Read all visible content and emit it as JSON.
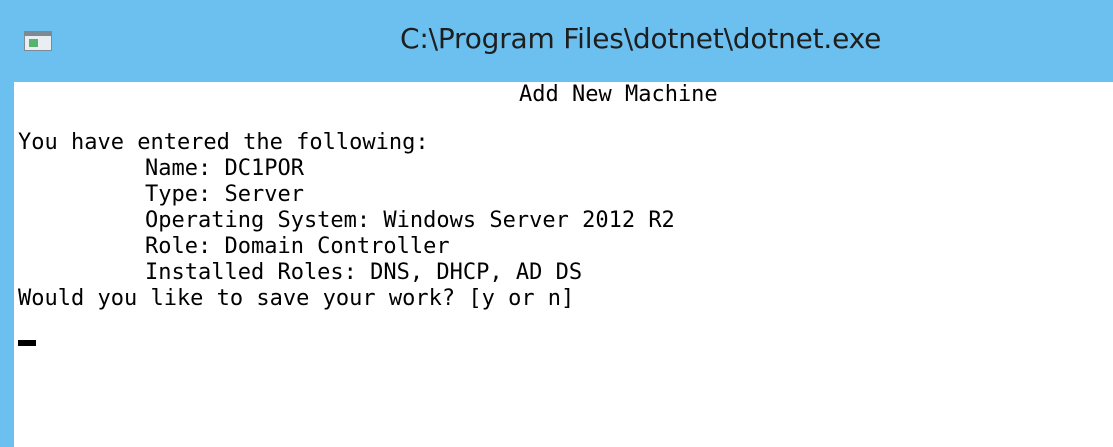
{
  "window": {
    "title": "C:\\Program Files\\dotnet\\dotnet.exe",
    "icon": "console-window-icon"
  },
  "console": {
    "heading": "Add New Machine",
    "intro": "You have entered the following:",
    "name_line": "Name: DC1POR",
    "type_line": "Type: Server",
    "os_line": "Operating System: Windows Server 2012 R2",
    "role_line": "Role: Domain Controller",
    "installed_roles_line": "Installed Roles: DNS, DHCP, AD DS",
    "prompt": "Would you like to save your work? [y or n]"
  },
  "colors": {
    "titlebar": "#6cc0ef",
    "console_bg": "#ffffff",
    "text": "#000000"
  }
}
